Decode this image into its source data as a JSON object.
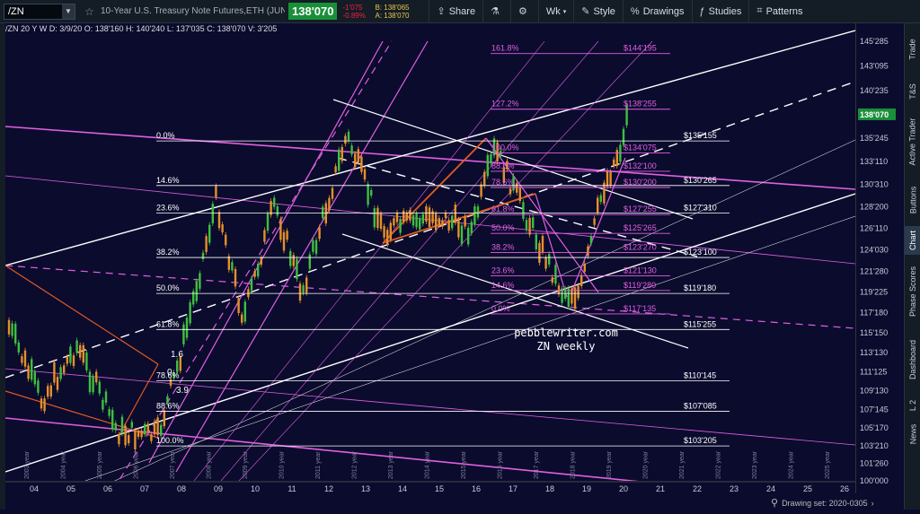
{
  "toolbar": {
    "symbol": "/ZN",
    "title": "10-Year U.S. Treasury Note Futures,ETH (JUN 20)",
    "last_price": "138'070",
    "change": "-1'075",
    "change_pct": "-0.89%",
    "bid": "B: 138'065",
    "ask": "A: 138'070",
    "share_label": "Share",
    "period_label": "Wk",
    "style_label": "Style",
    "drawings_label": "Drawings",
    "studies_label": "Studies",
    "patterns_label": "Patterns"
  },
  "chart_header": {
    "symbol": "/ZN 20 Y W",
    "date": "D: 3/9/20",
    "open": "O: 138'160",
    "high": "H: 140'240",
    "low": "L: 137'035",
    "close": "C: 138'070",
    "volume": "V: 3'205"
  },
  "right_tabs": [
    "Trade",
    "T&S",
    "Active Trader",
    "Buttons",
    "Chart",
    "Phase Scores",
    "Dashboard",
    "L 2",
    "News"
  ],
  "watermark": {
    "line1": "pebblewriter.com",
    "line2": "ZN weekly"
  },
  "status": {
    "drawing_set": "Drawing set: 2020-0305"
  },
  "colors": {
    "background": "#0b0b2e",
    "up_candle": "#3fbf3f",
    "down_candle": "#e4902a",
    "magenta": "#e060e0",
    "orange": "#e05a20",
    "price_badge": "#1a8f3a",
    "white": "#ffffff"
  },
  "chart_data": {
    "type": "candlestick",
    "x_axis_labels": [
      "04",
      "05",
      "06",
      "07",
      "08",
      "09",
      "10",
      "11",
      "12",
      "13",
      "14",
      "15",
      "16",
      "17",
      "18",
      "19",
      "20",
      "21",
      "22",
      "23",
      "24",
      "25",
      "26"
    ],
    "y_axis_labels": [
      "145'285",
      "143'095",
      "140'235",
      "138'070",
      "135'245",
      "133'110",
      "130'310",
      "128'200",
      "126'110",
      "124'030",
      "121'280",
      "119'225",
      "117'180",
      "115'150",
      "113'130",
      "111'125",
      "109'130",
      "107'145",
      "105'170",
      "103'210",
      "101'260",
      "100'000"
    ],
    "current_price": "138'070",
    "rotated_year_labels": [
      "2003 year",
      "2004 year",
      "2005 year",
      "2006 year",
      "2007 year",
      "2008 year",
      "2009 year",
      "2010 year",
      "2011 year",
      "2012 year",
      "2013 year",
      "2014 year",
      "2015 year",
      "2016 year",
      "2017 year",
      "2018 year",
      "2019 year",
      "2020 year",
      "2021 year",
      "2022 year",
      "2023 year",
      "2024 year",
      "2025 year"
    ],
    "fib_left": [
      {
        "label": "0.0%",
        "price": "135'155"
      },
      {
        "label": "14.6%",
        "price": "130'265"
      },
      {
        "label": "23.6%",
        "price": "127'310"
      },
      {
        "label": "38.2%",
        "price": "123'100"
      },
      {
        "label": "50.0%",
        "price": "119'180"
      },
      {
        "label": "61.8%",
        "price": "115'255"
      },
      {
        "label": "78.6%",
        "price": "110'145"
      },
      {
        "label": "88.6%",
        "price": "107'085"
      },
      {
        "label": "100.0%",
        "price": "103'205"
      }
    ],
    "fib_right": [
      {
        "label": "161.8%",
        "price": "144'195"
      },
      {
        "label": "127.2%",
        "price": "138'255"
      },
      {
        "label": "100.0%",
        "price": "134'075"
      },
      {
        "label": "88.6%",
        "price": "132'100"
      },
      {
        "label": "78.6%",
        "price": "130'200"
      },
      {
        "label": "61.8%",
        "price": "127'255"
      },
      {
        "label": "50.0%",
        "price": "125'265"
      },
      {
        "label": "38.2%",
        "price": "123'270"
      },
      {
        "label": "23.6%",
        "price": "121'130"
      },
      {
        "label": "14.6%",
        "price": "119'280"
      },
      {
        "label": "0.0%",
        "price": "117'135"
      }
    ],
    "annotations": [
      "1.6",
      "0",
      "3.9"
    ],
    "grid": false
  }
}
